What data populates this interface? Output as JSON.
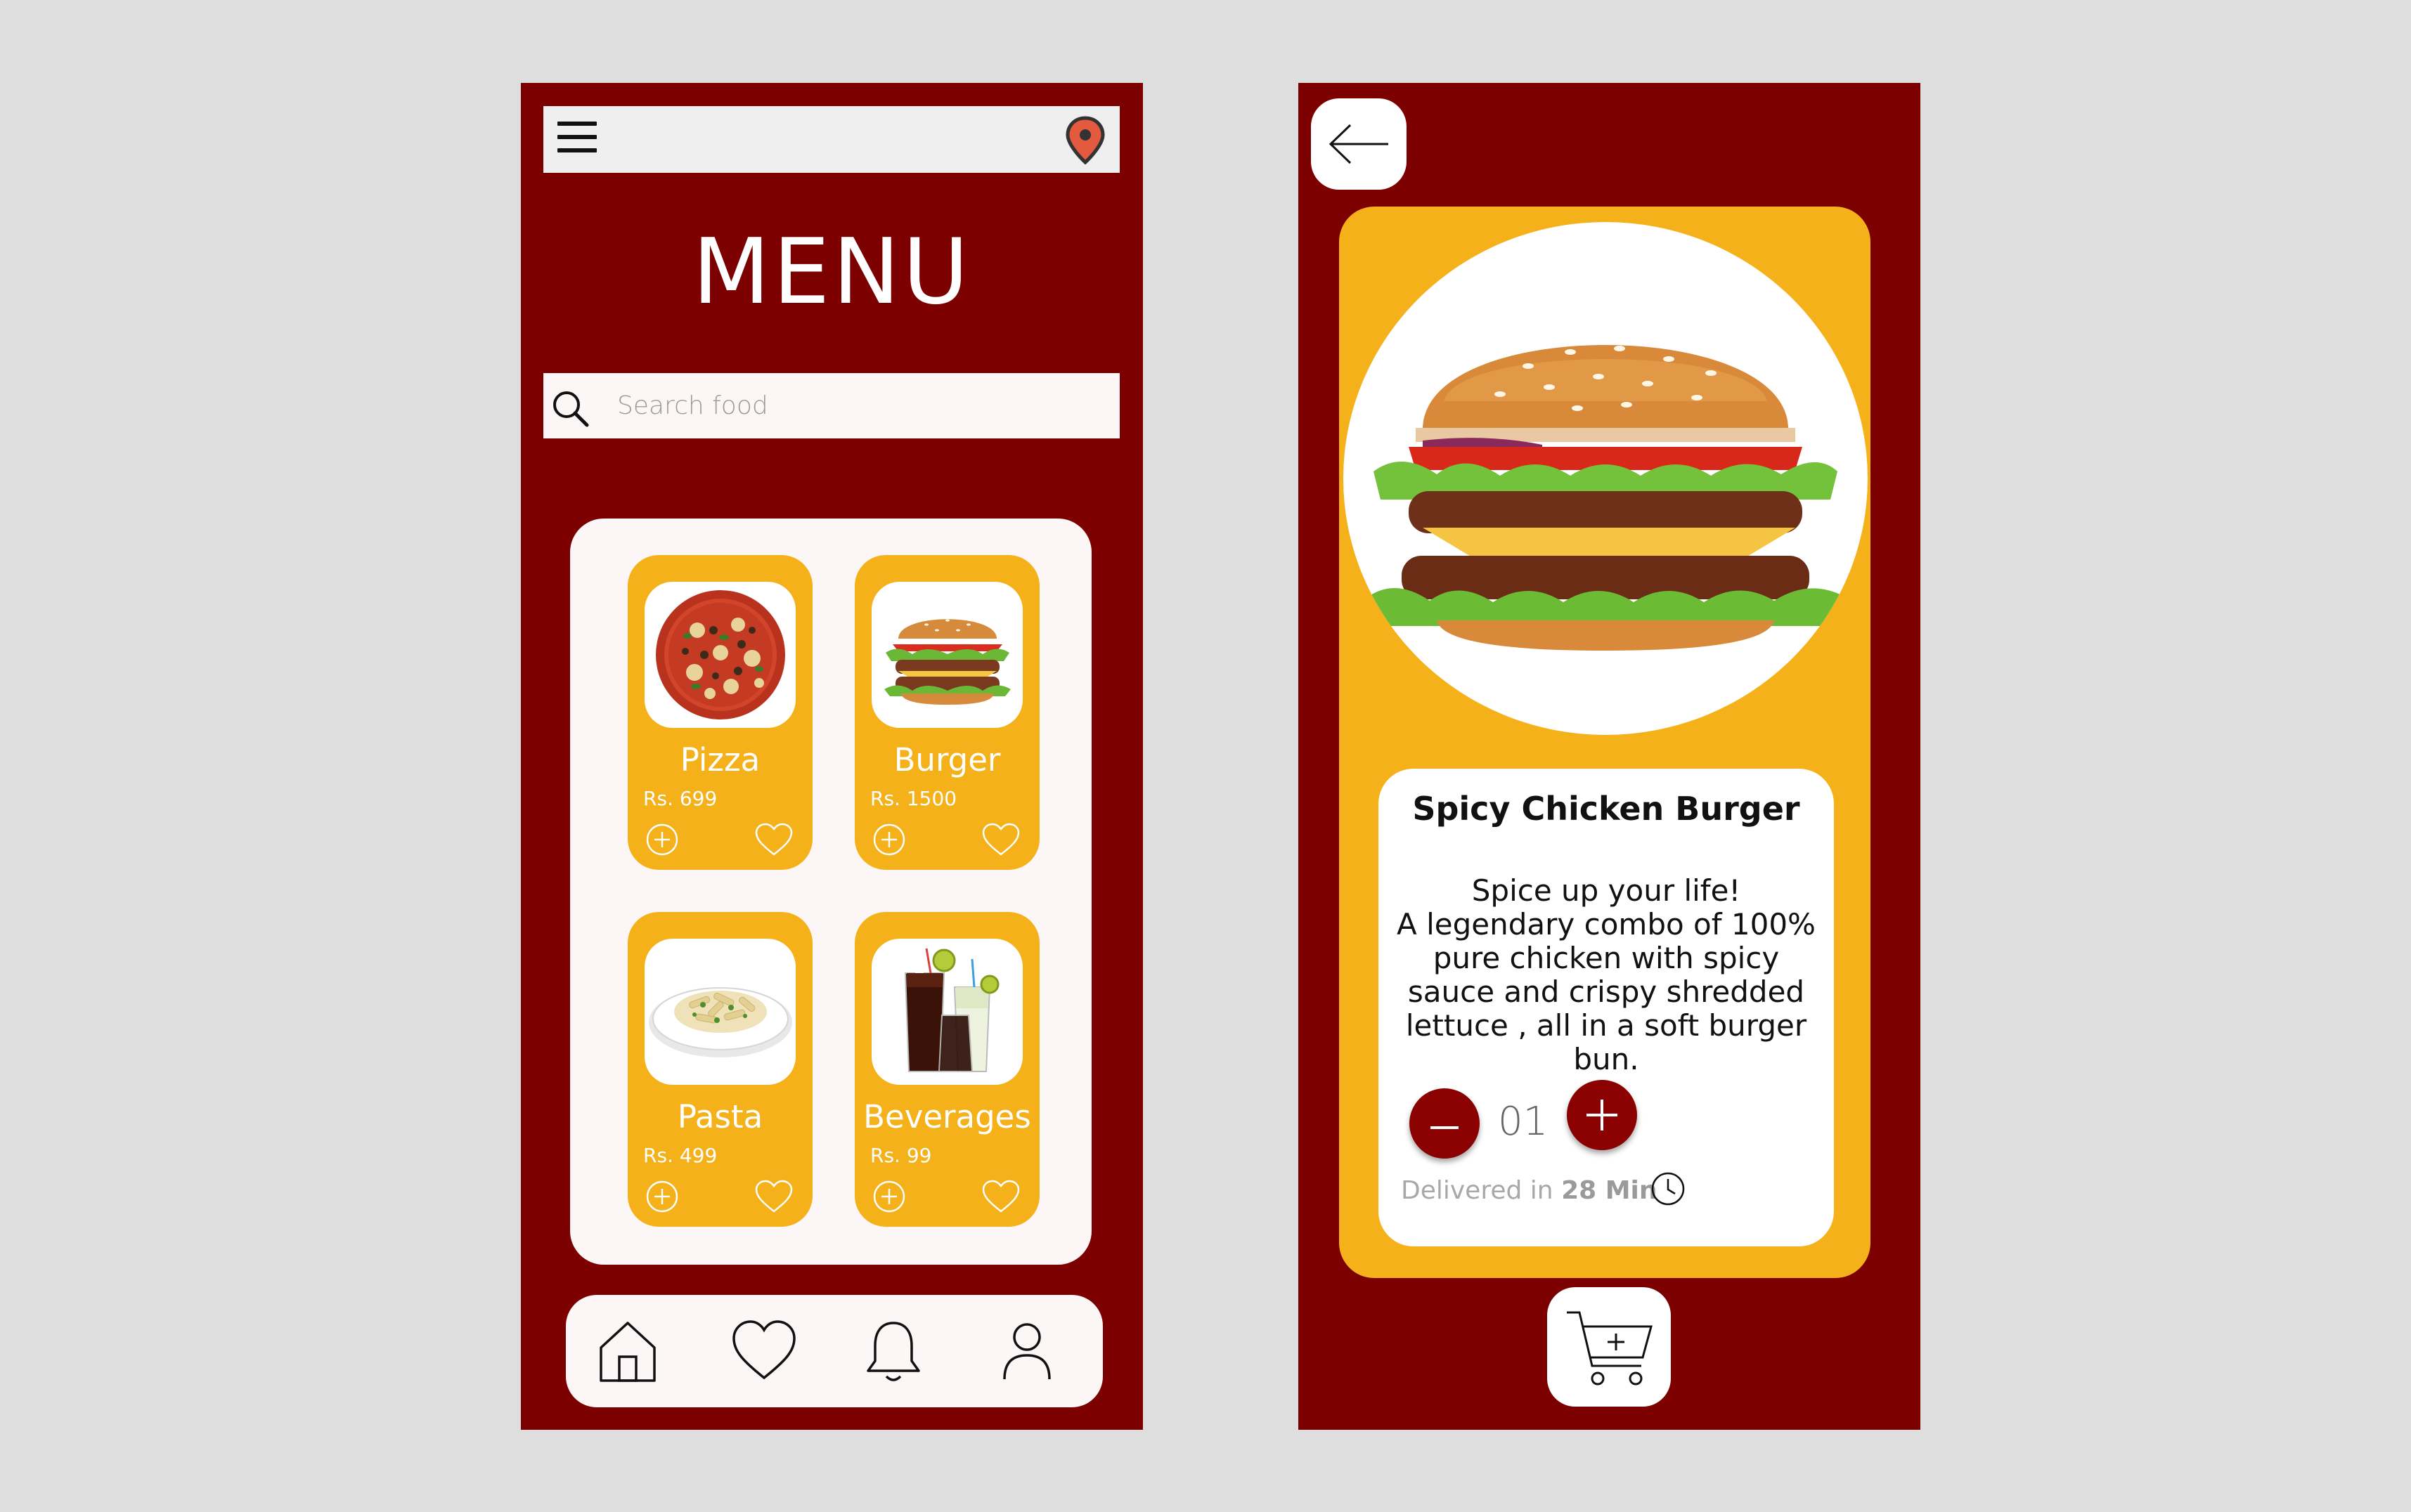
{
  "menu_screen": {
    "title": "MENU",
    "search": {
      "placeholder": "Search food"
    },
    "icons": {
      "menu": "hamburger-menu-icon",
      "location": "location-pin-icon",
      "search": "search-icon"
    },
    "foods": [
      {
        "name": "Pizza",
        "price": "Rs. 699"
      },
      {
        "name": "Burger",
        "price": "Rs. 1500"
      },
      {
        "name": "Pasta",
        "price": "Rs. 499"
      },
      {
        "name": "Beverages",
        "price": "Rs. 99"
      }
    ],
    "bottom_nav": [
      "home-icon",
      "heart-icon",
      "bell-icon",
      "user-icon"
    ]
  },
  "detail_screen": {
    "title": "Spicy Chicken Burger",
    "description": "Spice up your life!\nA legendary combo of 100% pure chicken with spicy sauce and crispy shredded lettuce , all in a soft burger bun.",
    "quantity": "01",
    "delivery_prefix": "Delivered in",
    "delivery_time": "28 Min",
    "icons": {
      "back": "arrow-left-icon",
      "cart": "add-to-cart-icon",
      "clock": "clock-icon"
    }
  },
  "colors": {
    "background": "#dedede",
    "primary": "#7d0000",
    "accent": "#f4b11a",
    "panel": "#fdf6f6",
    "quantity_button": "#8b0000"
  }
}
